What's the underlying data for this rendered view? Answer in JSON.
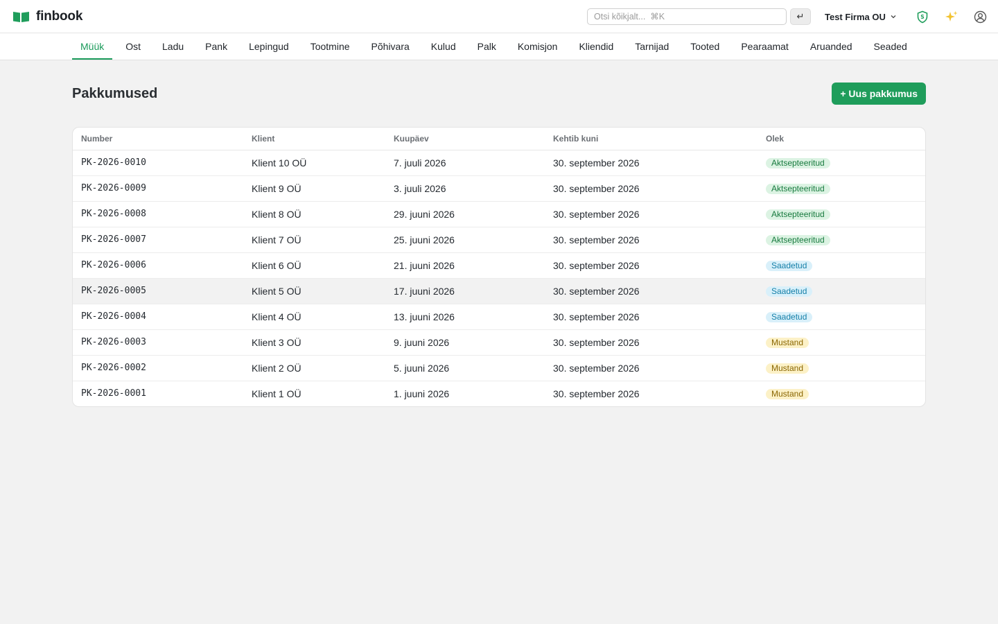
{
  "app": {
    "name": "finbook"
  },
  "header": {
    "search_placeholder": "Otsi kõikjalt...  ⌘K",
    "enter_label": "↵",
    "company": "Test Firma OU"
  },
  "nav": {
    "tabs": [
      {
        "label": "Müük",
        "active": true
      },
      {
        "label": "Ost"
      },
      {
        "label": "Ladu"
      },
      {
        "label": "Pank"
      },
      {
        "label": "Lepingud"
      },
      {
        "label": "Tootmine"
      },
      {
        "label": "Põhivara"
      },
      {
        "label": "Kulud"
      },
      {
        "label": "Palk"
      },
      {
        "label": "Komisjon"
      },
      {
        "label": "Kliendid"
      },
      {
        "label": "Tarnijad"
      },
      {
        "label": "Tooted"
      },
      {
        "label": "Pearaamat"
      },
      {
        "label": "Aruanded"
      },
      {
        "label": "Seaded"
      }
    ]
  },
  "page": {
    "title": "Pakkumused",
    "new_button": "+ Uus pakkumus"
  },
  "table": {
    "columns": [
      "Number",
      "Klient",
      "Kuupäev",
      "Kehtib kuni",
      "Olek"
    ],
    "rows": [
      {
        "number": "PK-2026-0010",
        "client": "Klient 10 OÜ",
        "date": "7. juuli 2026",
        "valid": "30. september 2026",
        "status": "Aktsepteeritud",
        "status_color": "green"
      },
      {
        "number": "PK-2026-0009",
        "client": "Klient 9 OÜ",
        "date": "3. juuli 2026",
        "valid": "30. september 2026",
        "status": "Aktsepteeritud",
        "status_color": "green"
      },
      {
        "number": "PK-2026-0008",
        "client": "Klient 8 OÜ",
        "date": "29. juuni 2026",
        "valid": "30. september 2026",
        "status": "Aktsepteeritud",
        "status_color": "green"
      },
      {
        "number": "PK-2026-0007",
        "client": "Klient 7 OÜ",
        "date": "25. juuni 2026",
        "valid": "30. september 2026",
        "status": "Aktsepteeritud",
        "status_color": "green"
      },
      {
        "number": "PK-2026-0006",
        "client": "Klient 6 OÜ",
        "date": "21. juuni 2026",
        "valid": "30. september 2026",
        "status": "Saadetud",
        "status_color": "blue"
      },
      {
        "number": "PK-2026-0005",
        "client": "Klient 5 OÜ",
        "date": "17. juuni 2026",
        "valid": "30. september 2026",
        "status": "Saadetud",
        "status_color": "blue"
      },
      {
        "number": "PK-2026-0004",
        "client": "Klient 4 OÜ",
        "date": "13. juuni 2026",
        "valid": "30. september 2026",
        "status": "Saadetud",
        "status_color": "blue"
      },
      {
        "number": "PK-2026-0003",
        "client": "Klient 3 OÜ",
        "date": "9. juuni 2026",
        "valid": "30. september 2026",
        "status": "Mustand",
        "status_color": "yellow"
      },
      {
        "number": "PK-2026-0002",
        "client": "Klient 2 OÜ",
        "date": "5. juuni 2026",
        "valid": "30. september 2026",
        "status": "Mustand",
        "status_color": "yellow"
      },
      {
        "number": "PK-2026-0001",
        "client": "Klient 1 OÜ",
        "date": "1. juuni 2026",
        "valid": "30. september 2026",
        "status": "Mustand",
        "status_color": "yellow"
      }
    ]
  },
  "colors": {
    "accent": "#1f9d5b",
    "status_green_bg": "#dcf3e3",
    "status_blue_bg": "#d9f0fa",
    "status_yellow_bg": "#fcf1c7"
  },
  "icons": [
    "book-logo-icon",
    "chevron-down-icon",
    "shield-icon",
    "sparkles-icon",
    "user-circle-icon"
  ]
}
